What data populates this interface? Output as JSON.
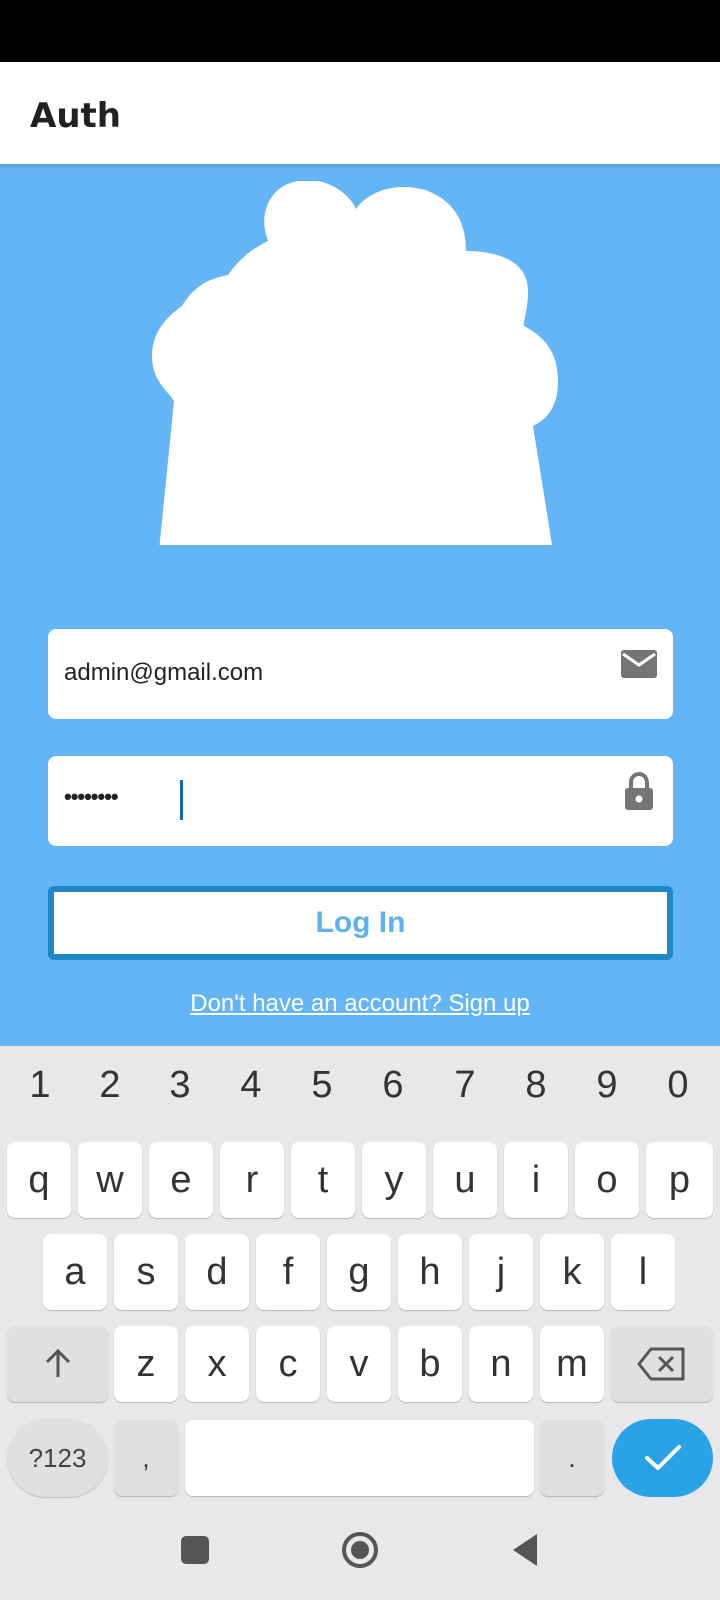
{
  "app": {
    "title": "Auth"
  },
  "form": {
    "email_value": "admin@gmail.com",
    "password_value": "••••••••",
    "login_label": "Log In",
    "signup_text": "Don't have an account? Sign up"
  },
  "icons": {
    "email": "email-icon",
    "lock": "lock-icon",
    "cloud": "cloud-logo"
  },
  "keyboard": {
    "numbers": [
      "1",
      "2",
      "3",
      "4",
      "5",
      "6",
      "7",
      "8",
      "9",
      "0"
    ],
    "row1": [
      "q",
      "w",
      "e",
      "r",
      "t",
      "y",
      "u",
      "i",
      "o",
      "p"
    ],
    "row2": [
      "a",
      "s",
      "d",
      "f",
      "g",
      "h",
      "j",
      "k",
      "l"
    ],
    "row3": [
      "z",
      "x",
      "c",
      "v",
      "b",
      "n",
      "m"
    ],
    "symbols_label": "?123",
    "comma": ",",
    "period": "."
  },
  "colors": {
    "background": "#64b5f6",
    "accent": "#1e88c7",
    "enter": "#2aa3e6"
  }
}
